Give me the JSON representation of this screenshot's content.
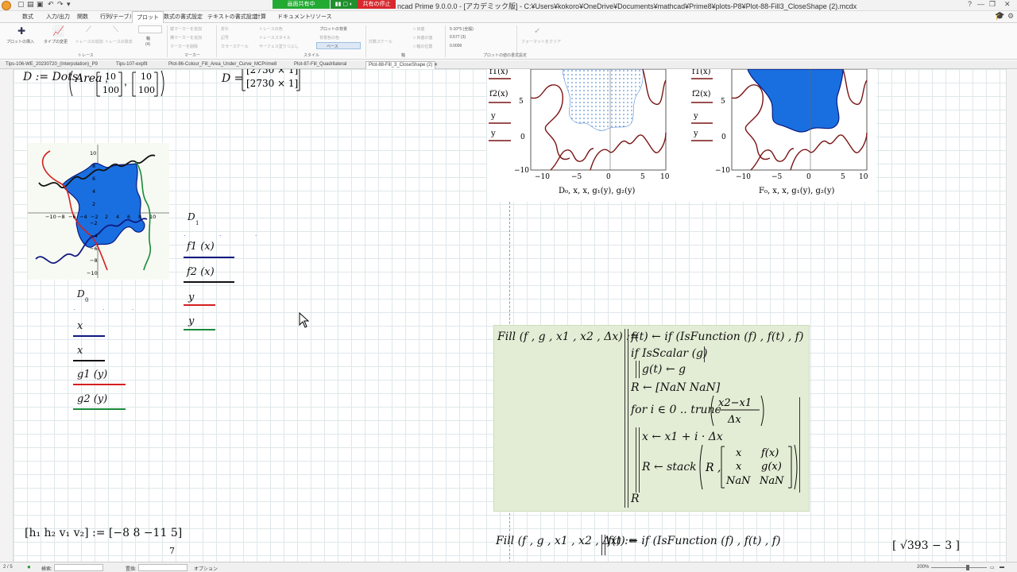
{
  "window": {
    "title": "Mathcad Prime 9.0.0.0 - [アカデミック版] - C:¥Users¥kokoro¥OneDrive¥Documents¥mathcad¥Prime8¥plots-P8¥Plot-88-Fill3_CloseShape (2).mcdx",
    "title_visible": "ncad Prime 9.0.0.0 - [アカデミック版] - C:¥Users¥kokoro¥OneDrive¥Documents¥mathcad¥Prime8¥plots-P8¥Plot-88-Fill3_CloseShape (2).mcdx",
    "share_on": "画面共有中",
    "share_stop": "共有の停止"
  },
  "menu": [
    "数式",
    "入力/出力",
    "関数",
    "行列/テーブル",
    "プロット",
    "数式の書式設定",
    "テキストの書式設定",
    "計算",
    "ドキュメント",
    "リソース"
  ],
  "ribbon": {
    "insert_plot": "プロットの挿入",
    "change_type": "タイプの変更",
    "add_trace": "トレースの追加",
    "remove_trace": "トレースの除去",
    "axis_count": "(4)",
    "axis_label": "軸",
    "add_marker_v": "縦マーカーを追加",
    "add_marker_h": "横マーカーを追加",
    "remove_marker": "マーカーを削除",
    "line": "折れ",
    "symbol": "記号",
    "color_scale": "カラースケール",
    "trace_color": "トレースの色",
    "trace_style": "トレーススタイル",
    "surface_fill": "サーフェス塗りつぶし",
    "plot_bg": "プロットの背景",
    "plot_bg_color": "背景色の色",
    "base": "ベース",
    "scale_label": "対数スケール",
    "num_format": "表示形式",
    "num_sample": "5·10^5 (全般)",
    "num_sample2": "0.577 (3)",
    "num_sample3": "0.0000",
    "clear_format": "フォーマットをクリア",
    "groups": [
      "トレース",
      "マーカー",
      "スタイル",
      "軸",
      "プロットの値の書式設定"
    ]
  },
  "doc_tabs": [
    "Tips-106-WE_20230720_(Interpolation)_P9",
    "Tips-107-expfit",
    "Plot-86-Colour_Fill_Area_Under_Curve_MCPrime8",
    "Plot-87-Fill_Quadrilateral",
    "Plot-88-Fill_3_CloseShape (2)"
  ],
  "active_tab": 4,
  "worksheet": {
    "def_D": "D := Dots",
    "def_D_args": [
      "Area",
      "10",
      "100",
      "10",
      "100"
    ],
    "res_D_label": "D =",
    "res_D": [
      "[2730 × 1]",
      "[2730 × 1]"
    ],
    "plot1_legend_y": [
      "D",
      "1",
      "f1 (x)",
      "f2 (x)",
      "y",
      "y"
    ],
    "plot1_legend_x": [
      "D",
      "0",
      "x",
      "x",
      "g1 (y)",
      "g2 (y)"
    ],
    "plot1_ticks_x": [
      "−10",
      "−8",
      "−6",
      "−4",
      "−2",
      "0",
      "2",
      "4",
      "6",
      "8",
      "10"
    ],
    "plot1_ticks_y": [
      "10",
      "8",
      "6",
      "4",
      "2",
      "−2",
      "−4",
      "−6",
      "−8",
      "−10"
    ],
    "plot2_legend": [
      "f1(x)",
      "f2(x)",
      "y",
      "y"
    ],
    "plot2_ticks_y": [
      "5",
      "0",
      "−5",
      "−10"
    ],
    "plot2_ticks_x": [
      "−10",
      "−5",
      "0",
      "5",
      "10"
    ],
    "plot2_xlabel": "D₀, x, x, g₁(y), g₂(y)",
    "plot3_legend": [
      "f1(x)",
      "f2(x)",
      "y",
      "y"
    ],
    "plot3_ticks_y": [
      "5",
      "0",
      "−5",
      "−10"
    ],
    "plot3_ticks_x": [
      "−10",
      "−5",
      "0",
      "5",
      "10"
    ],
    "plot3_xlabel": "F₀, x, x, g₁(y), g₂(y)",
    "fill_def": "Fill (f , g , x1 , x2 , Δx) :=",
    "fill_lines": [
      "f(t) ← if (IsFunction (f) , f(t) , f)",
      "if IsScalar (g)",
      "g(t) ← g",
      "R ← [NaN  NaN]",
      "for i ∈ 0 .. trunc",
      "x2−x1",
      "Δx",
      "x ← x1 + i · Δx",
      "R ← stack",
      "R ,",
      "x",
      "f(x)",
      "x",
      "g(x)",
      "NaN",
      "NaN",
      "R"
    ],
    "fill_def2": "Fill (f , g , x1 , x2 , Δx) :=",
    "fill_line2": "f(t) ← if (IsFunction (f) , f(t) , f)",
    "hv_def": "[h₁  h₂  v₁  v₂] := [−8  8  −11  5]",
    "sqrt_expr": "√393 − 3",
    "partial_7": "7"
  },
  "status": {
    "page": "2 / 5",
    "search": "検索:",
    "replace": "置換:",
    "options": "オプション",
    "zoom": "200%"
  },
  "colors": {
    "fill_blue": "#1a6fe0",
    "dark_red": "#8b1a1a",
    "red": "#d42020",
    "navy": "#101880",
    "green": "#1a8a3a",
    "box_green": "#e3edd5"
  }
}
